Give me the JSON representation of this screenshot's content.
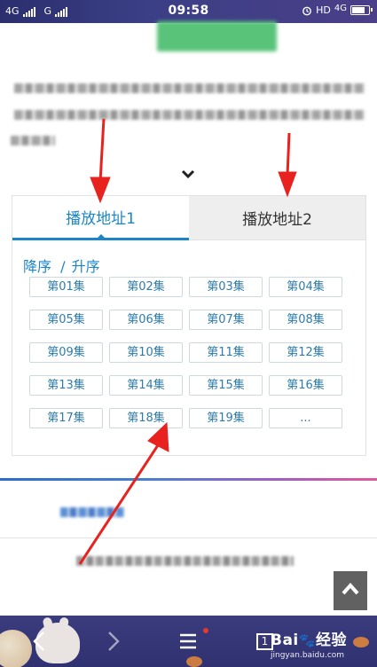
{
  "status_bar": {
    "sim1": "4G",
    "sim2": "G",
    "time": "09:58",
    "hd": "HD",
    "network": "4G"
  },
  "tabs": [
    {
      "label": "播放地址1",
      "active": true
    },
    {
      "label": "播放地址2",
      "active": false
    }
  ],
  "order": {
    "desc_label": "降序",
    "separator": "/",
    "asc_label": "升序"
  },
  "episodes": [
    "第01集",
    "第02集",
    "第03集",
    "第04集",
    "第05集",
    "第06集",
    "第07集",
    "第08集",
    "第09集",
    "第10集",
    "第11集",
    "第12集",
    "第13集",
    "第14集",
    "第15集",
    "第16集",
    "第17集",
    "第18集",
    "第19集",
    "..."
  ],
  "bottom_bar": {
    "tab_count": "1",
    "watermark_brand": "Bai",
    "watermark_brand_cn": "经验",
    "watermark_url": "jingyan.baidu.com"
  },
  "colors": {
    "accent": "#1b86c7",
    "annotation_red": "#e8231f",
    "back_to_top_bg": "#616161"
  },
  "icons": [
    "chevron-down-icon",
    "back-to-top-icon",
    "back-arrow-icon",
    "forward-arrow-icon",
    "menu-icon",
    "tabs-icon",
    "alarm-icon",
    "battery-icon",
    "signal-icon"
  ]
}
